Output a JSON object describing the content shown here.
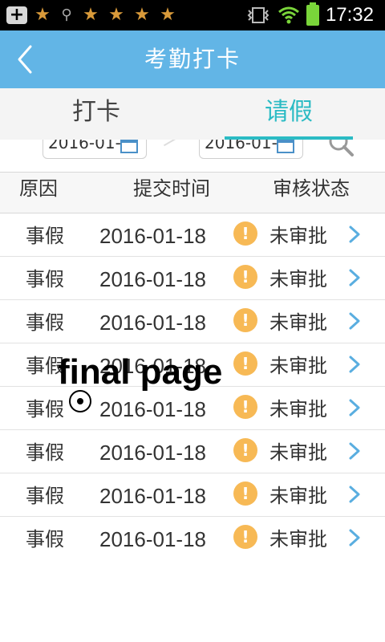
{
  "status_bar": {
    "time": "17:32",
    "icons": [
      "add-icon",
      "squirrel-app-icon",
      "search-icon",
      "squirrel-app-icon",
      "squirrel-app-icon",
      "squirrel-app-icon",
      "squirrel-app-icon",
      "vibrate-icon",
      "wifi-icon",
      "battery-icon"
    ]
  },
  "header": {
    "title": "考勤打卡",
    "back_icon": "back-arrow-icon",
    "color": "#62b5e6"
  },
  "tabs": [
    {
      "label": "打卡",
      "active": false
    },
    {
      "label": "请假",
      "active": true
    }
  ],
  "filter": {
    "start_date": "2016-01-",
    "end_date": "2016-01-",
    "calendar_icon": "calendar-icon",
    "search_icon": "search-icon"
  },
  "table": {
    "columns": [
      "原因",
      "提交时间",
      "审核状态"
    ],
    "rows": [
      {
        "reason": "事假",
        "date": "2016-01-18",
        "status": "未审批"
      },
      {
        "reason": "事假",
        "date": "2016-01-18",
        "status": "未审批"
      },
      {
        "reason": "事假",
        "date": "2016-01-18",
        "status": "未审批"
      },
      {
        "reason": "事假",
        "date": "2016-01-18",
        "status": "未审批"
      },
      {
        "reason": "事假",
        "date": "2016-01-18",
        "status": "未审批"
      },
      {
        "reason": "事假",
        "date": "2016-01-18",
        "status": "未审批"
      },
      {
        "reason": "事假",
        "date": "2016-01-18",
        "status": "未审批"
      },
      {
        "reason": "事假",
        "date": "2016-01-18",
        "status": "未审批"
      }
    ],
    "status_icon": "warning-icon",
    "status_icon_glyph": "!",
    "status_color": "#f7b955"
  },
  "overlay": {
    "text": "final page"
  },
  "accent_color": "#2bbbc4"
}
